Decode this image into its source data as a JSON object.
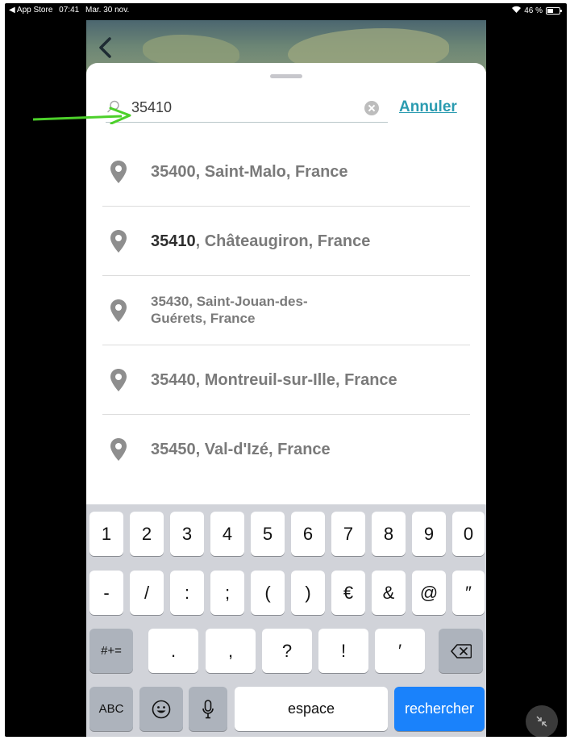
{
  "status_bar": {
    "back_app": "◀ App Store",
    "time": "07:41",
    "date": "Mar. 30 nov.",
    "wifi": "᯼",
    "battery": "46 %"
  },
  "search": {
    "value": "35410",
    "cancel_label": "Annuler"
  },
  "results": [
    {
      "highlight": "",
      "text": "35400, Saint-Malo, France"
    },
    {
      "highlight": "35410",
      "text": ", Châteaugiron, France"
    },
    {
      "highlight": "",
      "line1": "35430, Saint-Jouan-des-",
      "line2": "Guérets, France"
    },
    {
      "highlight": "",
      "text": "35440, Montreuil-sur-Ille, France"
    },
    {
      "highlight": "",
      "text": "35450, Val-d'Izé, France"
    }
  ],
  "keyboard": {
    "row1": [
      "1",
      "2",
      "3",
      "4",
      "5",
      "6",
      "7",
      "8",
      "9",
      "0"
    ],
    "row2": [
      "-",
      "/",
      ":",
      ";",
      "(",
      ")",
      "€",
      "&",
      "@",
      "″"
    ],
    "row3": [
      ".",
      ",",
      "?",
      "!",
      "′"
    ],
    "row3_mode": "#+=",
    "abc": "ABC",
    "space": "espace",
    "action": "rechercher"
  },
  "colors": {
    "accent": "#2a9bb0",
    "keyboard_action": "#1a82fb",
    "annotation_arrow": "#4cd02a"
  }
}
